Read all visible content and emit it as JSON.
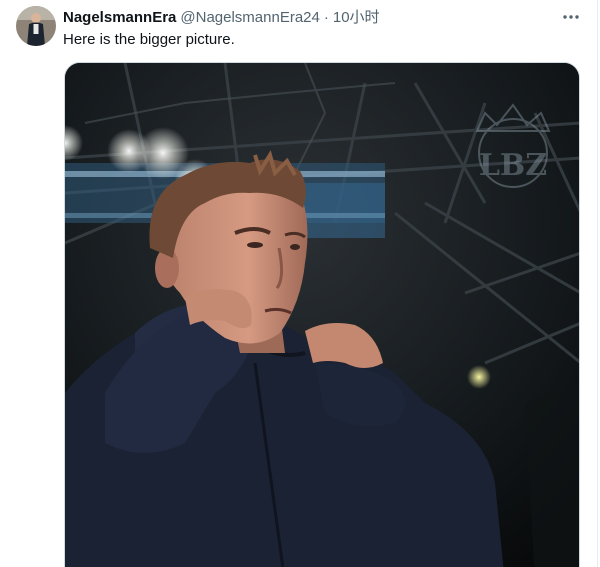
{
  "author": {
    "display_name": "NagelsmannEra",
    "handle": "@NagelsmannEra24",
    "separator": "·",
    "time": "10小时"
  },
  "tweet": {
    "text": "Here is the bigger picture."
  },
  "media": {
    "watermark_text": "LBZ"
  },
  "icons": {
    "more": "more-horizontal-icon"
  }
}
